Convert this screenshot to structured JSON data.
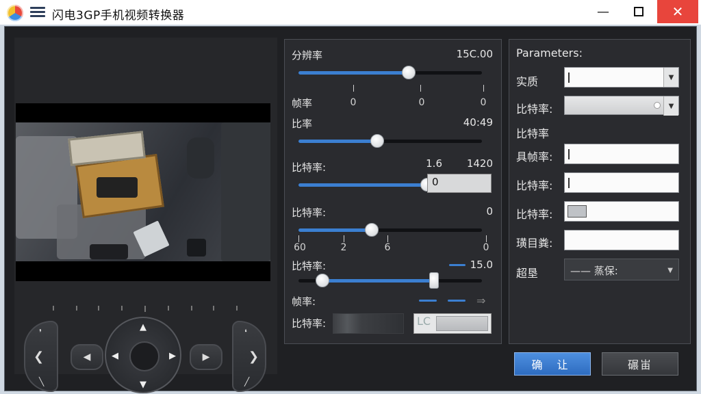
{
  "window": {
    "title": "闪电3GP手机视频转换器",
    "minimize": "—",
    "close": "✕"
  },
  "controls": {
    "arrow_up": "▲",
    "arrow_down": "▼",
    "arrow_left": "◀",
    "arrow_right": "▶",
    "pill_left": "◀",
    "pill_right": "▶",
    "arc_left": "❮",
    "arc_right": "❯"
  },
  "sliders": {
    "s1": {
      "label": "分辨率",
      "value_text": "15C.00",
      "fraction": 0.6
    },
    "s1_ticks": {
      "label": "帧率",
      "ticks": [
        "0",
        "0",
        "0"
      ]
    },
    "s2": {
      "label": "比率",
      "value_text": "40:49",
      "fraction": 0.43
    },
    "s3": {
      "label": "比特率:",
      "value_a": "1.6",
      "value_b": "1420",
      "input": "0",
      "fraction": 0.7
    },
    "s4": {
      "label": "比特率:",
      "value_text": "0",
      "fraction": 0.4,
      "ticks": [
        "60",
        "2",
        "6",
        "0"
      ]
    },
    "s5": {
      "label": "比特率:",
      "value_text": "15.0",
      "fraction_start": 0.13,
      "fraction_end": 0.74
    },
    "row_fps": {
      "label": "帧率:",
      "arrow": "⇒"
    },
    "row_bitrate": {
      "label": "比特率:",
      "box_text": "LC"
    }
  },
  "params": {
    "title": "Parameters:",
    "rows": [
      {
        "label": "实质"
      },
      {
        "label": "比特率:"
      },
      {
        "label": "比特率"
      },
      {
        "label": "具帧率:"
      },
      {
        "label": "比特率:"
      },
      {
        "label": "比特率:"
      },
      {
        "label": "璜目粪:"
      },
      {
        "label": "超垦",
        "value": "—— 蒸保:"
      }
    ]
  },
  "buttons": {
    "ok": "确 让",
    "cancel": "碾峀"
  }
}
